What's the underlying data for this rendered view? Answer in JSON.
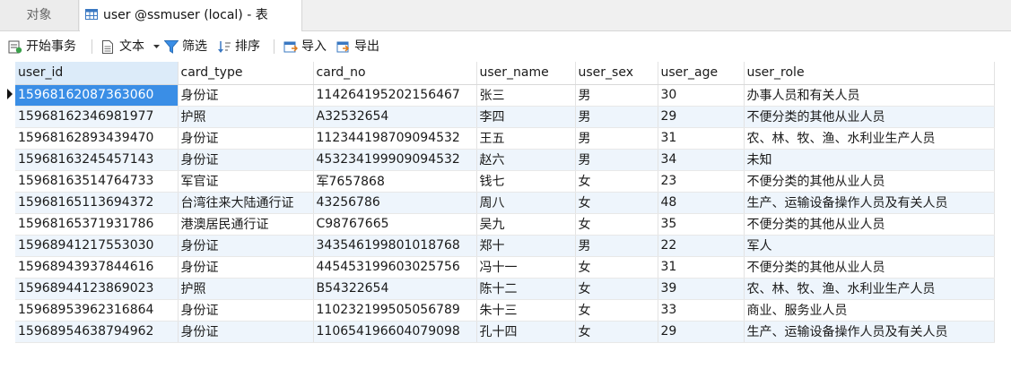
{
  "tabs": {
    "objects_label": "对象",
    "active_label": "user @ssmuser (local) - 表"
  },
  "toolbar": {
    "begin_transaction": "开始事务",
    "text": "文本",
    "filter": "筛选",
    "sort": "排序",
    "import": "导入",
    "export": "导出"
  },
  "colors": {
    "selected_cell": "#3a8ee6",
    "selected_header": "#dcebf9",
    "alt_row": "#eef5fc"
  },
  "table": {
    "columns": [
      "user_id",
      "card_type",
      "card_no",
      "user_name",
      "user_sex",
      "user_age",
      "user_role"
    ],
    "rows": [
      [
        "15968162087363060",
        "身份证",
        "11426419520215646​7",
        "张三",
        "男",
        "30",
        "办事人员和有关人员"
      ],
      [
        "15968162346981977",
        "护照",
        "A32532654",
        "李四",
        "男",
        "29",
        "不便分类的其他从业人员"
      ],
      [
        "15968162893439470",
        "身份证",
        "112344198709094532",
        "王五",
        "男",
        "31",
        "农、林、牧、渔、水利业生产人员"
      ],
      [
        "15968163245457143",
        "身份证",
        "453234199909094532",
        "赵六",
        "男",
        "34",
        "未知"
      ],
      [
        "15968163514764733",
        "军官证",
        "军7657868",
        "钱七",
        "女",
        "23",
        "不便分类的其他从业人员"
      ],
      [
        "15968165113694372",
        "台湾往来大陆通行证",
        "43256786",
        "周八",
        "女",
        "48",
        "生产、运输设备操作人员及有关人员"
      ],
      [
        "15968165371931786",
        "港澳居民通行证",
        "C98767665",
        "吴九",
        "女",
        "35",
        "不便分类的其他从业人员"
      ],
      [
        "15968941217553030",
        "身份证",
        "343546199801018768",
        "郑十",
        "男",
        "22",
        "军人"
      ],
      [
        "15968943937844616",
        "身份证",
        "445453199603025756",
        "冯十一",
        "女",
        "31",
        "不便分类的其他从业人员"
      ],
      [
        "15968944123869023",
        "护照",
        "B54322654",
        "陈十二",
        "女",
        "39",
        "农、林、牧、渔、水利业生产人员"
      ],
      [
        "15968953962316864",
        "身份证",
        "110232199505056789",
        "朱十三",
        "女",
        "33",
        "商业、服务业人员"
      ],
      [
        "15968954638794962",
        "身份证",
        "110654196604079098",
        "孔十四",
        "女",
        "29",
        "生产、运输设备操作人员及有关人员"
      ]
    ]
  }
}
